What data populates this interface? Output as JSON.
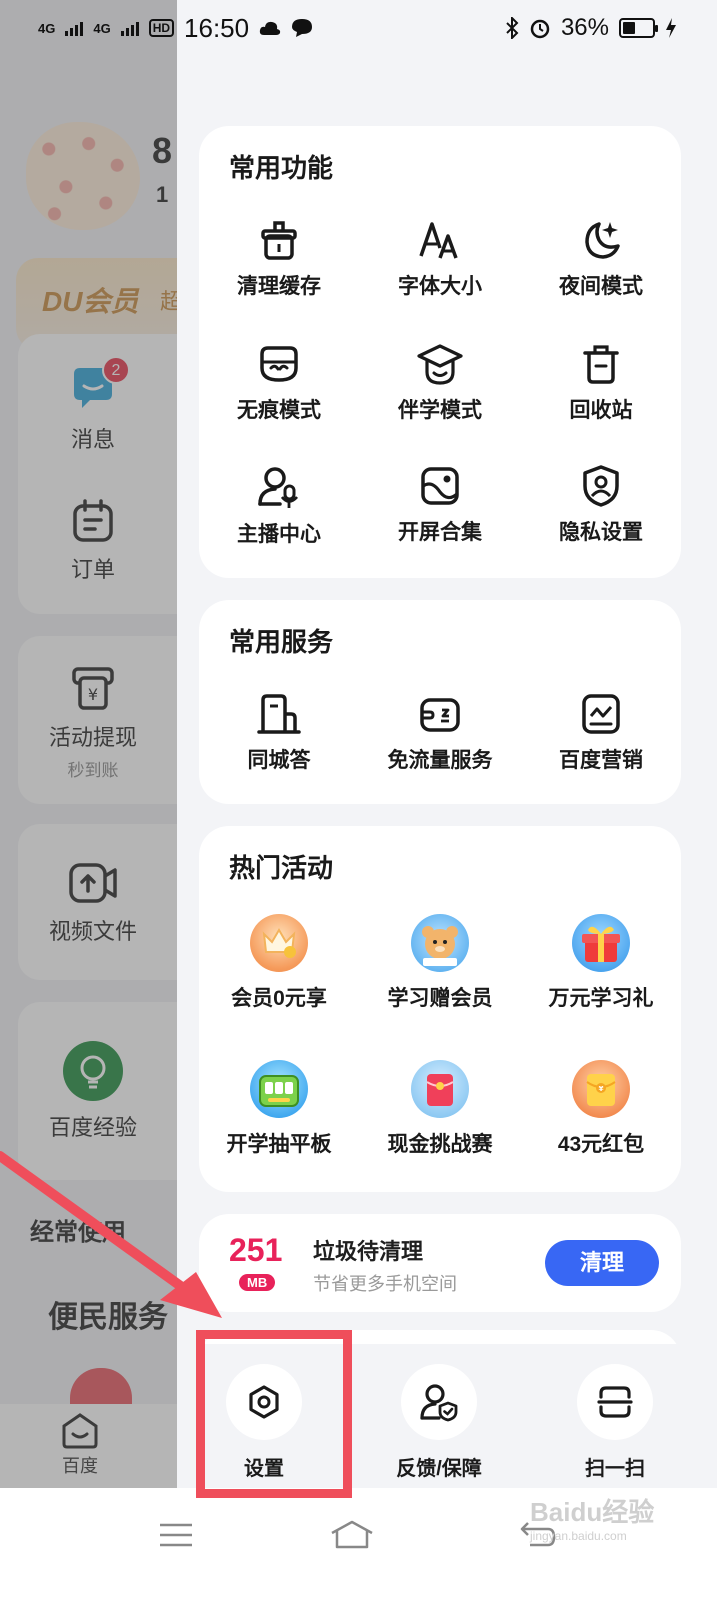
{
  "status_bar": {
    "network1": "4G",
    "network2": "4G",
    "hd": "HD",
    "time": "16:50",
    "battery_percent": "36%",
    "battery_level": 0.36
  },
  "background": {
    "name_fragment": "8",
    "sub_fragment": "1",
    "vip_logo": "DU会员",
    "vip_side": "超",
    "items": [
      {
        "label": "消息",
        "badge": "2",
        "icon": "message-icon"
      },
      {
        "label": "订单",
        "icon": "order-icon"
      },
      {
        "label": "活动提现",
        "sub": "秒到账",
        "icon": "withdraw-icon"
      },
      {
        "label": "视频文件",
        "icon": "video-file-icon"
      },
      {
        "label": "百度经验",
        "icon": "baidu-experience-icon"
      }
    ],
    "section_often": "经常使用",
    "section_service": "便民服务",
    "nav_home": "百度"
  },
  "drawer": {
    "common_functions": {
      "title": "常用功能",
      "items": [
        {
          "label": "清理缓存",
          "icon": "clean-cache-icon"
        },
        {
          "label": "字体大小",
          "icon": "font-size-icon"
        },
        {
          "label": "夜间模式",
          "icon": "night-mode-icon"
        },
        {
          "label": "无痕模式",
          "icon": "incognito-icon"
        },
        {
          "label": "伴学模式",
          "icon": "study-mode-icon"
        },
        {
          "label": "回收站",
          "icon": "trash-icon"
        },
        {
          "label": "主播中心",
          "icon": "anchor-center-icon"
        },
        {
          "label": "开屏合集",
          "icon": "splash-collection-icon"
        },
        {
          "label": "隐私设置",
          "icon": "privacy-icon"
        }
      ]
    },
    "common_services": {
      "title": "常用服务",
      "items": [
        {
          "label": "同城答",
          "icon": "local-answer-icon"
        },
        {
          "label": "免流量服务",
          "icon": "free-data-icon"
        },
        {
          "label": "百度营销",
          "icon": "marketing-icon"
        }
      ]
    },
    "hot_activities": {
      "title": "热门活动",
      "items": [
        {
          "label": "会员0元享",
          "icon": "vip-free-icon"
        },
        {
          "label": "学习赠会员",
          "icon": "study-gift-icon"
        },
        {
          "label": "万元学习礼",
          "icon": "gift-box-icon"
        },
        {
          "label": "开学抽平板",
          "icon": "tablet-lottery-icon"
        },
        {
          "label": "现金挑战赛",
          "icon": "cash-challenge-icon"
        },
        {
          "label": "43元红包",
          "icon": "red-packet-icon"
        }
      ]
    },
    "cleanup": {
      "amount": "251",
      "unit": "MB",
      "title": "垃圾待清理",
      "subtitle": "节省更多手机空间",
      "button": "清理"
    },
    "bottom": {
      "settings": "设置",
      "feedback": "反馈/保障",
      "scan": "扫一扫"
    }
  },
  "watermark": {
    "text": "Baidu经验",
    "sub": "jingyan.baidu.com"
  },
  "colors": {
    "accent_blue": "#3867f4",
    "cleanup_red": "#e8225a",
    "highlight_red": "#ef4e5b"
  }
}
